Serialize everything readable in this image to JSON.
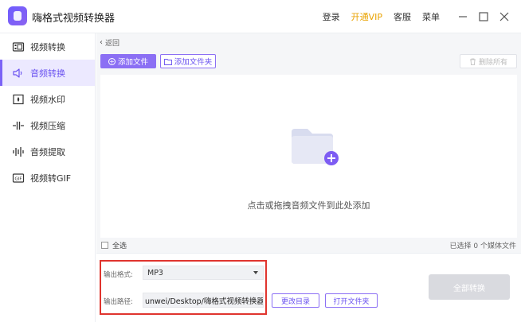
{
  "app": {
    "title": "嗨格式视频转换器",
    "accent_color": "#7b63f6"
  },
  "topbar": {
    "login": "登录",
    "vip": "开通VIP",
    "service": "客服",
    "menu": "菜单"
  },
  "sidebar": {
    "items": [
      {
        "label": "视频转换",
        "icon": "film-icon",
        "active": false
      },
      {
        "label": "音频转换",
        "icon": "speaker-icon",
        "active": true
      },
      {
        "label": "视频水印",
        "icon": "watermark-icon",
        "active": false
      },
      {
        "label": "视频压缩",
        "icon": "compress-icon",
        "active": false
      },
      {
        "label": "音频提取",
        "icon": "waveform-icon",
        "active": false
      },
      {
        "label": "视频转GIF",
        "icon": "gif-icon",
        "active": false
      }
    ]
  },
  "main": {
    "back_label": "返回",
    "add_file_label": "添加文件",
    "add_folder_label": "添加文件夹",
    "delete_all_label": "删除所有",
    "drop_hint": "点击或拖拽音频文件到此处添加",
    "select_all_label": "全选",
    "selected_count": "已选择 0 个媒体文件"
  },
  "output": {
    "format_label": "输出格式:",
    "format_value": "MP3",
    "path_label": "输出路径:",
    "path_value": "unwei/Desktop/嗨格式视频转换器",
    "change_dir_label": "更改目录",
    "open_folder_label": "打开文件夹",
    "convert_all_label": "全部转换"
  }
}
